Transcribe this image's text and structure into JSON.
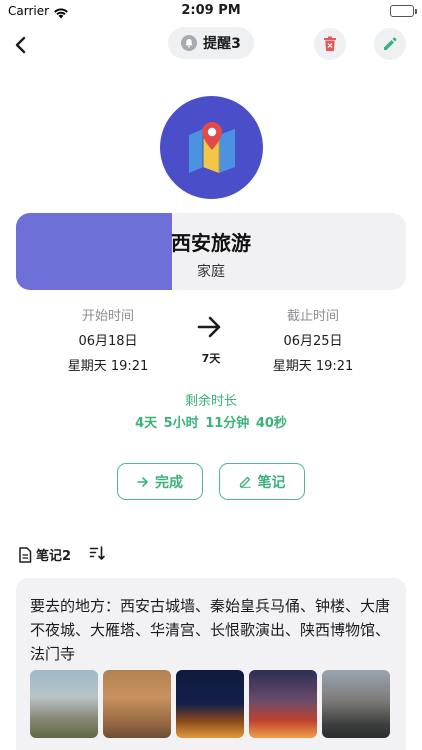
{
  "status_bar": {
    "carrier": "Carrier",
    "time": "2:09 PM"
  },
  "nav": {
    "reminder_label": "提醒3",
    "icons": {
      "back": "chevron-left-icon",
      "bell": "bell-icon",
      "delete": "trash-icon",
      "edit": "pencil-icon"
    },
    "colors": {
      "delete": "#e15a5a",
      "edit": "#3bb27a"
    }
  },
  "event": {
    "title": "西安旅游",
    "category": "家庭",
    "progress": 0.4,
    "hero_icon": "map-pin-icon",
    "colors": {
      "hero_bg": "#4a4fc9",
      "progress": "#6e70d8"
    }
  },
  "time": {
    "start_label": "开始时间",
    "start_date": "06月18日",
    "start_weekday": "星期天 19:21",
    "end_label": "截止时间",
    "end_date": "06月25日",
    "end_weekday": "星期天 19:21",
    "duration": "7天"
  },
  "remaining": {
    "label": "剩余时长",
    "value": "4天  5小时  11分钟  40秒"
  },
  "actions": {
    "complete_label": "完成",
    "note_label": "笔记",
    "accent": "#3bb27a"
  },
  "notes": {
    "header": "笔记2",
    "items": [
      {
        "text": "要去的地方：西安古城墙、秦始皇兵马俑、钟楼、大唐不夜城、大雁塔、华清宫、长恨歌演出、陕西博物馆、法门寺"
      }
    ]
  }
}
